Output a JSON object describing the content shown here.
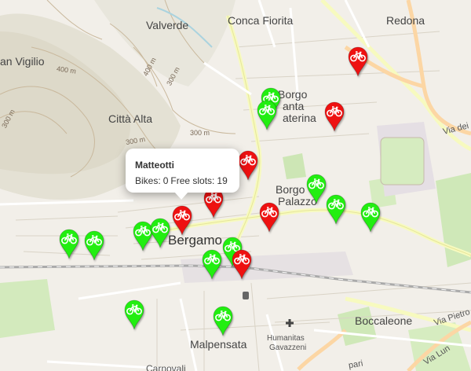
{
  "places": {
    "conca_fiorita": "Conca Fiorita",
    "redona": "Redona",
    "valverde": "Valverde",
    "san_vigilio": "an Vigilio",
    "borgo_santa_caterina": [
      "Borgo",
      "anta",
      "aterina"
    ],
    "citta_alta": "Città Alta",
    "borgo_palazzo": [
      "Borgo",
      "Palazzo"
    ],
    "bergamo": "Bergamo",
    "via_dei": "Via dei",
    "boccaleone": "Boccaleone",
    "via_pietro": "Via Pietro",
    "humanitas": [
      "Humanitas",
      "Gavazzeni"
    ],
    "malpensata": "Malpensata",
    "carnovali": "Carnovali",
    "via_lun": "Via Lun",
    "pari": "pari"
  },
  "contours": {
    "c400a": "400 m",
    "c400b": "400 m",
    "c300a": "300 m",
    "c300b": "300 m",
    "c300c": "300 m",
    "c300d": "300 m"
  },
  "popup": {
    "title": "Matteotti",
    "bikes_label": "Bikes:",
    "bikes_value": "0",
    "slots_label": "Free slots:",
    "slots_value": "19"
  },
  "colors": {
    "available": "#22ee11",
    "empty": "#ee1111"
  },
  "stations": [
    {
      "status": "available"
    },
    {
      "status": "available"
    },
    {
      "status": "available"
    },
    {
      "status": "available"
    },
    {
      "status": "available"
    },
    {
      "status": "available"
    },
    {
      "status": "available"
    },
    {
      "status": "available"
    },
    {
      "status": "available"
    },
    {
      "status": "available"
    },
    {
      "status": "available"
    },
    {
      "status": "available"
    },
    {
      "status": "available"
    },
    {
      "status": "empty"
    },
    {
      "status": "empty"
    },
    {
      "status": "empty"
    },
    {
      "status": "empty"
    },
    {
      "status": "empty"
    },
    {
      "status": "empty"
    },
    {
      "status": "empty"
    },
    {
      "status": "empty"
    }
  ]
}
